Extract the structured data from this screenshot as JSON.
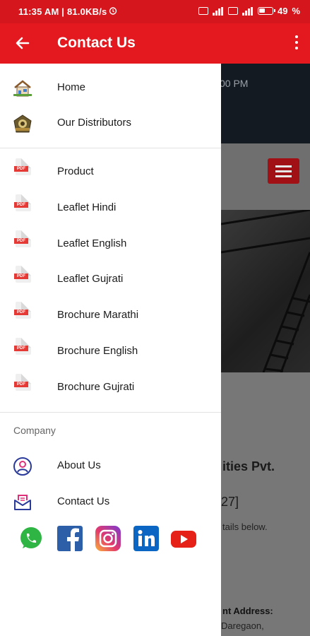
{
  "status_bar": {
    "time_info": "11:35 AM | 81.0KB/s",
    "battery": "49"
  },
  "app_bar": {
    "title": "Contact Us"
  },
  "drawer": {
    "top_items": [
      {
        "label": "Home",
        "icon": "home-icon"
      },
      {
        "label": "Our Distributors",
        "icon": "distributors-icon"
      }
    ],
    "pdf_items": [
      {
        "label": "Product"
      },
      {
        "label": "Leaflet Hindi"
      },
      {
        "label": "Leaflet English"
      },
      {
        "label": "Leaflet Gujrati"
      },
      {
        "label": "Brochure Marathi"
      },
      {
        "label": "Brochure English"
      },
      {
        "label": "Brochure Gujrati"
      }
    ],
    "pdf_badge": "PDF",
    "section_title": "Company",
    "company_items": [
      {
        "label": "About Us",
        "icon": "user-circle-icon"
      },
      {
        "label": "Contact Us",
        "icon": "mail-icon"
      }
    ],
    "social": [
      "whatsapp-icon",
      "facebook-icon",
      "instagram-icon",
      "linkedin-icon",
      "youtube-icon"
    ]
  },
  "background": {
    "time_fragment": "00 PM",
    "company_fragment": "ities Pvt.",
    "code_fragment": "27]",
    "details_fragment": "tails below.",
    "address_label_fragment": "nt Address:",
    "address_fragment": "Daregaon,"
  },
  "colors": {
    "primary_red": "#e3191f",
    "status_red": "#d6161d"
  }
}
